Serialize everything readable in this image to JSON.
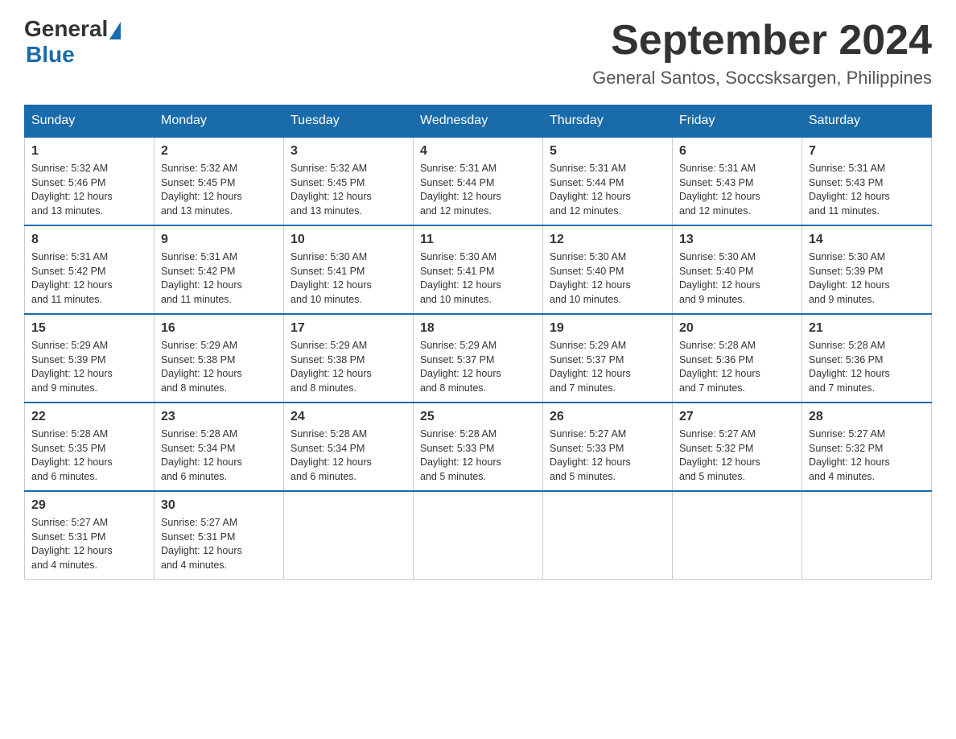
{
  "header": {
    "logo_general": "General",
    "logo_blue": "Blue",
    "month_title": "September 2024",
    "location": "General Santos, Soccsksargen, Philippines"
  },
  "days_of_week": [
    "Sunday",
    "Monday",
    "Tuesday",
    "Wednesday",
    "Thursday",
    "Friday",
    "Saturday"
  ],
  "weeks": [
    [
      {
        "day": "1",
        "sunrise": "5:32 AM",
        "sunset": "5:46 PM",
        "daylight": "12 hours and 13 minutes."
      },
      {
        "day": "2",
        "sunrise": "5:32 AM",
        "sunset": "5:45 PM",
        "daylight": "12 hours and 13 minutes."
      },
      {
        "day": "3",
        "sunrise": "5:32 AM",
        "sunset": "5:45 PM",
        "daylight": "12 hours and 13 minutes."
      },
      {
        "day": "4",
        "sunrise": "5:31 AM",
        "sunset": "5:44 PM",
        "daylight": "12 hours and 12 minutes."
      },
      {
        "day": "5",
        "sunrise": "5:31 AM",
        "sunset": "5:44 PM",
        "daylight": "12 hours and 12 minutes."
      },
      {
        "day": "6",
        "sunrise": "5:31 AM",
        "sunset": "5:43 PM",
        "daylight": "12 hours and 12 minutes."
      },
      {
        "day": "7",
        "sunrise": "5:31 AM",
        "sunset": "5:43 PM",
        "daylight": "12 hours and 11 minutes."
      }
    ],
    [
      {
        "day": "8",
        "sunrise": "5:31 AM",
        "sunset": "5:42 PM",
        "daylight": "12 hours and 11 minutes."
      },
      {
        "day": "9",
        "sunrise": "5:31 AM",
        "sunset": "5:42 PM",
        "daylight": "12 hours and 11 minutes."
      },
      {
        "day": "10",
        "sunrise": "5:30 AM",
        "sunset": "5:41 PM",
        "daylight": "12 hours and 10 minutes."
      },
      {
        "day": "11",
        "sunrise": "5:30 AM",
        "sunset": "5:41 PM",
        "daylight": "12 hours and 10 minutes."
      },
      {
        "day": "12",
        "sunrise": "5:30 AM",
        "sunset": "5:40 PM",
        "daylight": "12 hours and 10 minutes."
      },
      {
        "day": "13",
        "sunrise": "5:30 AM",
        "sunset": "5:40 PM",
        "daylight": "12 hours and 9 minutes."
      },
      {
        "day": "14",
        "sunrise": "5:30 AM",
        "sunset": "5:39 PM",
        "daylight": "12 hours and 9 minutes."
      }
    ],
    [
      {
        "day": "15",
        "sunrise": "5:29 AM",
        "sunset": "5:39 PM",
        "daylight": "12 hours and 9 minutes."
      },
      {
        "day": "16",
        "sunrise": "5:29 AM",
        "sunset": "5:38 PM",
        "daylight": "12 hours and 8 minutes."
      },
      {
        "day": "17",
        "sunrise": "5:29 AM",
        "sunset": "5:38 PM",
        "daylight": "12 hours and 8 minutes."
      },
      {
        "day": "18",
        "sunrise": "5:29 AM",
        "sunset": "5:37 PM",
        "daylight": "12 hours and 8 minutes."
      },
      {
        "day": "19",
        "sunrise": "5:29 AM",
        "sunset": "5:37 PM",
        "daylight": "12 hours and 7 minutes."
      },
      {
        "day": "20",
        "sunrise": "5:28 AM",
        "sunset": "5:36 PM",
        "daylight": "12 hours and 7 minutes."
      },
      {
        "day": "21",
        "sunrise": "5:28 AM",
        "sunset": "5:36 PM",
        "daylight": "12 hours and 7 minutes."
      }
    ],
    [
      {
        "day": "22",
        "sunrise": "5:28 AM",
        "sunset": "5:35 PM",
        "daylight": "12 hours and 6 minutes."
      },
      {
        "day": "23",
        "sunrise": "5:28 AM",
        "sunset": "5:34 PM",
        "daylight": "12 hours and 6 minutes."
      },
      {
        "day": "24",
        "sunrise": "5:28 AM",
        "sunset": "5:34 PM",
        "daylight": "12 hours and 6 minutes."
      },
      {
        "day": "25",
        "sunrise": "5:28 AM",
        "sunset": "5:33 PM",
        "daylight": "12 hours and 5 minutes."
      },
      {
        "day": "26",
        "sunrise": "5:27 AM",
        "sunset": "5:33 PM",
        "daylight": "12 hours and 5 minutes."
      },
      {
        "day": "27",
        "sunrise": "5:27 AM",
        "sunset": "5:32 PM",
        "daylight": "12 hours and 5 minutes."
      },
      {
        "day": "28",
        "sunrise": "5:27 AM",
        "sunset": "5:32 PM",
        "daylight": "12 hours and 4 minutes."
      }
    ],
    [
      {
        "day": "29",
        "sunrise": "5:27 AM",
        "sunset": "5:31 PM",
        "daylight": "12 hours and 4 minutes."
      },
      {
        "day": "30",
        "sunrise": "5:27 AM",
        "sunset": "5:31 PM",
        "daylight": "12 hours and 4 minutes."
      },
      null,
      null,
      null,
      null,
      null
    ]
  ]
}
